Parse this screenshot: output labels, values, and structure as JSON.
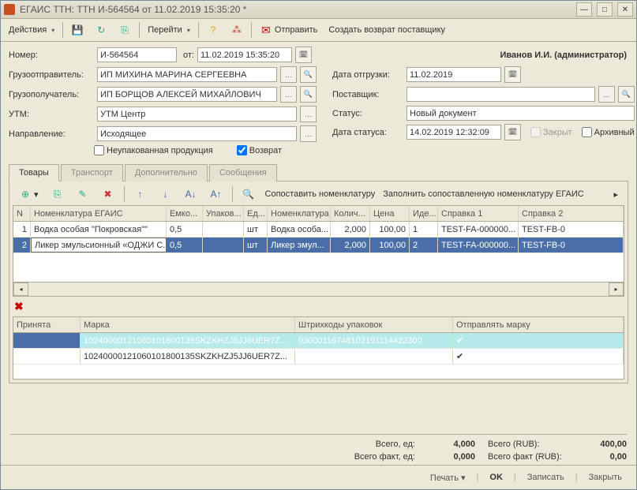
{
  "window": {
    "title": "ЕГАИС ТТН: ТТН И-564564 от 11.02.2019 15:35:20 *"
  },
  "toolbar": {
    "actions": "Действия",
    "goto": "Перейти",
    "send": "Отправить",
    "create_return": "Создать возврат поставщику"
  },
  "header": {
    "number_lbl": "Номер:",
    "number": "И-564564",
    "from_lbl": "от:",
    "date": "11.02.2019 15:35:20",
    "user": "Иванов И.И. (администратор)",
    "shipper_lbl": "Грузоотправитель:",
    "shipper": "ИП МИХИНА МАРИНА СЕРГЕЕВНА",
    "consignee_lbl": "Грузополучатель:",
    "consignee": "ИП БОРЩОВ АЛЕКСЕЙ МИХАЙЛОВИЧ",
    "utm_lbl": "УТМ:",
    "utm": "УТМ Центр",
    "direction_lbl": "Направление:",
    "direction": "Исходящее",
    "ship_date_lbl": "Дата отгрузки:",
    "ship_date": "11.02.2019",
    "supplier_lbl": "Поставщик:",
    "supplier": "",
    "status_lbl": "Статус:",
    "status": "Новый документ",
    "status_date_lbl": "Дата статуса:",
    "status_date": "14.02.2019 12:32:09",
    "closed_lbl": "Закрыт",
    "archive_lbl": "Архивный",
    "unpacked_lbl": "Неупакованная продукция",
    "return_lbl": "Возврат"
  },
  "tabs": {
    "goods": "Товары",
    "transport": "Транспорт",
    "additional": "Дополнительно",
    "messages": "Сообщения"
  },
  "subtoolbar": {
    "match": "Сопоставить номенклатуру",
    "fill": "Заполнить сопоставленную номенклатуру ЕГАИС"
  },
  "grid1": {
    "cols": [
      "N",
      "Номенклатура ЕГАИС",
      "Емко...",
      "Упаков...",
      "Ед...",
      "Номенклатура",
      "Колич...",
      "Цена",
      "Иде...",
      "Справка 1",
      "Справка 2"
    ],
    "rows": [
      {
        "n": "1",
        "nom_egais": "Водка особая \"Покровская\"\"",
        "cap": "0,5",
        "pack": "",
        "unit": "шт",
        "nom": "Водка особа...",
        "qty": "2,000",
        "price": "100,00",
        "ident": "1",
        "ref1": "TEST-FA-000000...",
        "ref2": "TEST-FB-0"
      },
      {
        "n": "2",
        "nom_egais": "Ликер эмульсионный «ОДЖИ С...",
        "cap": "0,5",
        "pack": "",
        "unit": "шт",
        "nom": "Ликер эмул...",
        "qty": "2,000",
        "price": "100,00",
        "ident": "2",
        "ref1": "TEST-FA-000000...",
        "ref2": "TEST-FB-0"
      }
    ]
  },
  "grid2": {
    "cols": [
      "Принята",
      "Марка",
      "Штрихкоды упаковок",
      "Отправлять марку"
    ],
    "rows": [
      {
        "accepted": "",
        "mark": "10240000121060101800135SKZKHZJ5JJ6UER7Z...",
        "barcode": "03000116748102191114422300",
        "send": true
      },
      {
        "accepted": "",
        "mark": "10240000121060101800135SKZKHZJ5JJ6UER7Z...",
        "barcode": "",
        "send": true
      }
    ]
  },
  "totals": {
    "total_qty_lbl": "Всего, ед:",
    "total_qty": "4,000",
    "total_rub_lbl": "Всего (RUB):",
    "total_rub": "400,00",
    "fact_qty_lbl": "Всего факт, ед:",
    "fact_qty": "0,000",
    "fact_rub_lbl": "Всего факт (RUB):",
    "fact_rub": "0,00"
  },
  "footer": {
    "print": "Печать",
    "ok": "OK",
    "save": "Записать",
    "close": "Закрыть"
  }
}
